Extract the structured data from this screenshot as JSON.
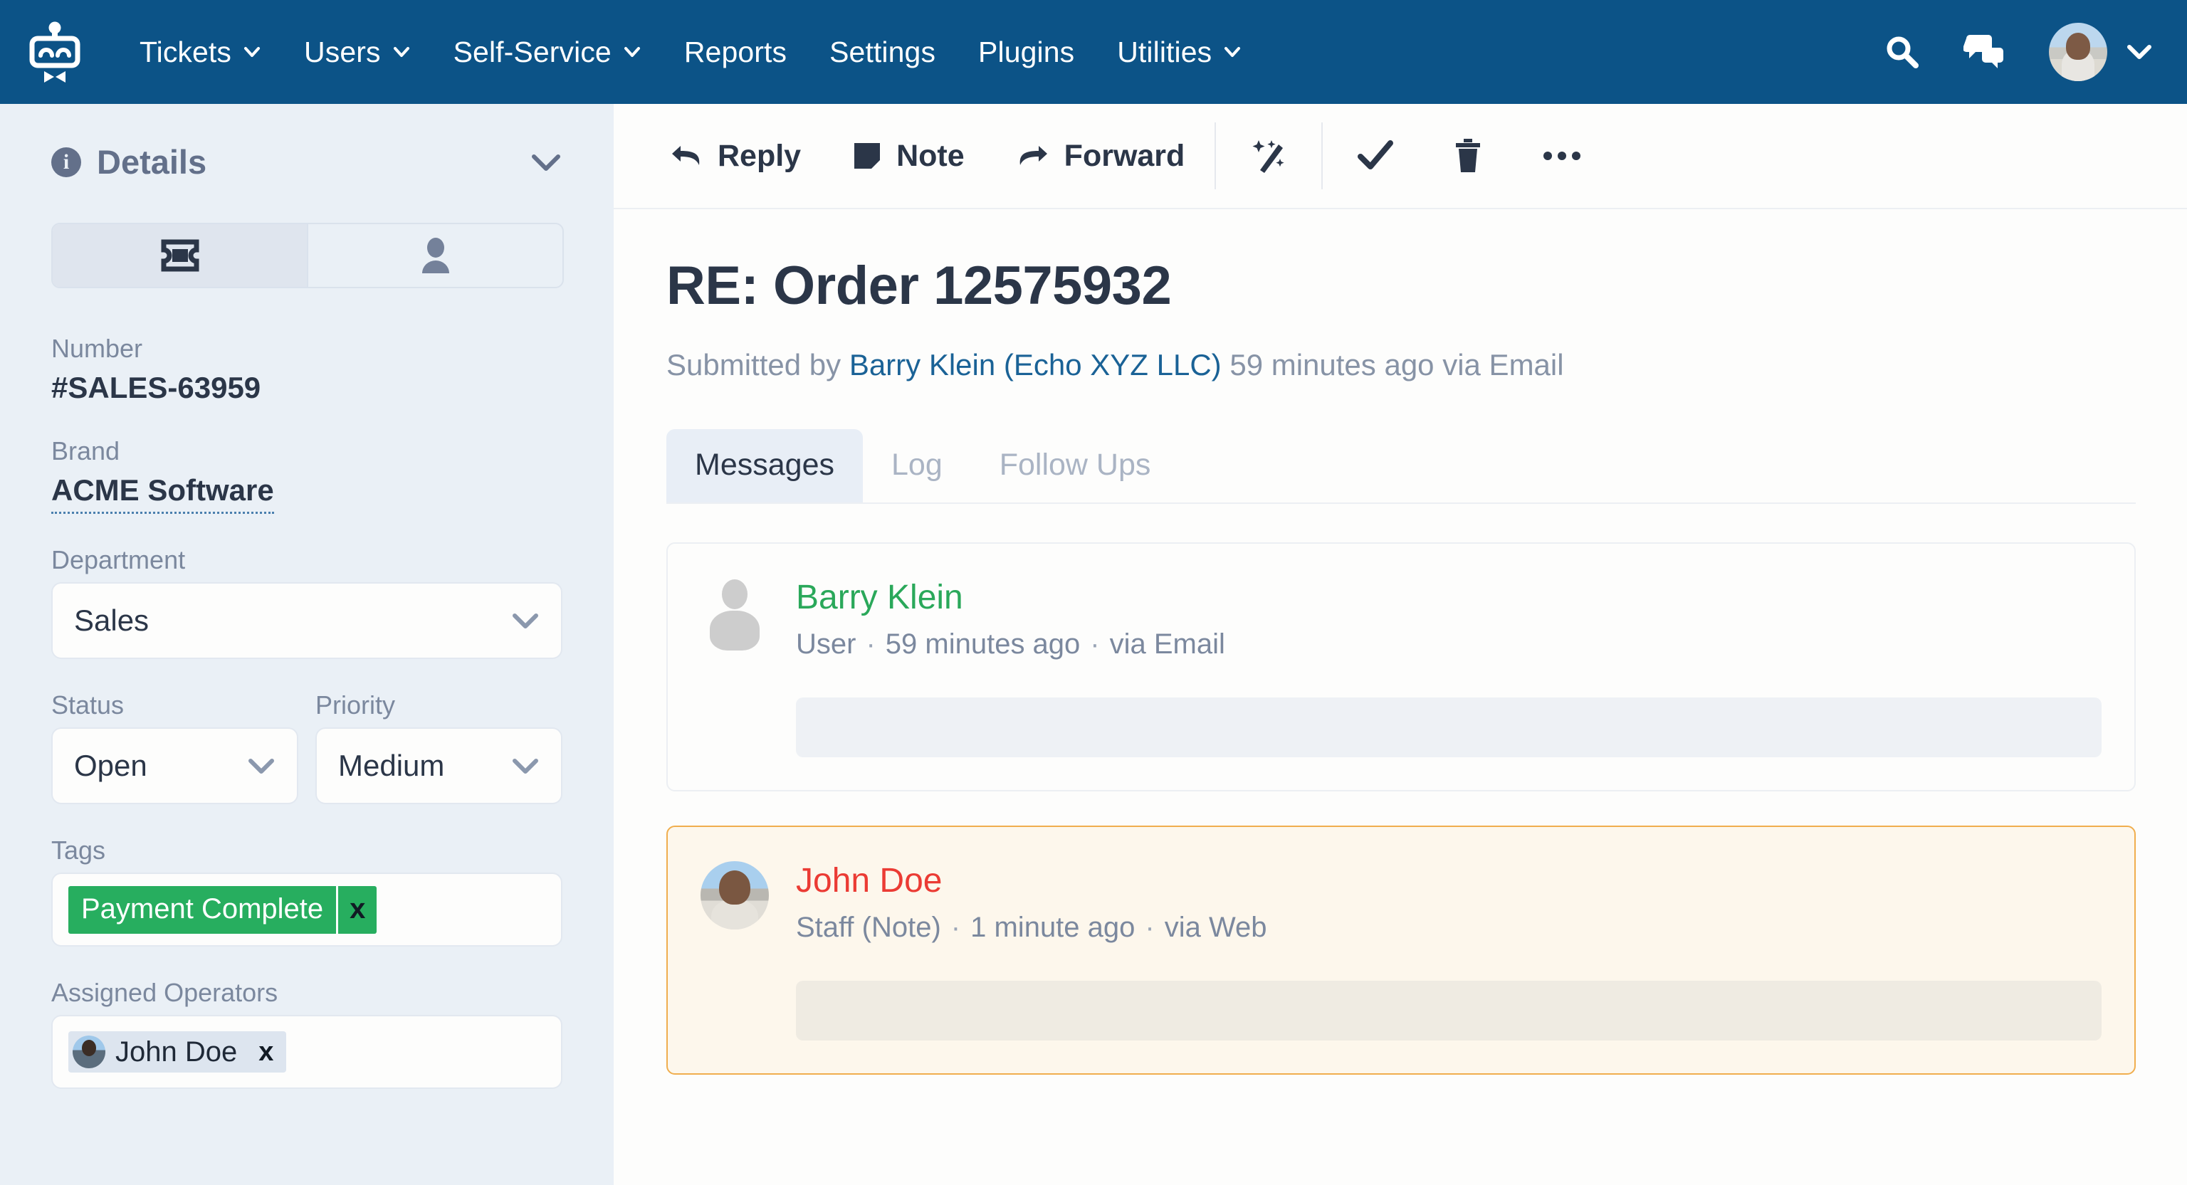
{
  "nav": {
    "logo_icon": "robot-logo-icon",
    "items": [
      {
        "label": "Tickets",
        "has_caret": true
      },
      {
        "label": "Users",
        "has_caret": true
      },
      {
        "label": "Self-Service",
        "has_caret": true
      },
      {
        "label": "Reports",
        "has_caret": false
      },
      {
        "label": "Settings",
        "has_caret": false
      },
      {
        "label": "Plugins",
        "has_caret": false
      },
      {
        "label": "Utilities",
        "has_caret": true
      }
    ],
    "search_icon": "search-icon",
    "chat_icon": "chat-bubbles-icon",
    "avatar_icon": "user-avatar",
    "account_caret_icon": "chevron-down-icon",
    "background_color": "#0c5387"
  },
  "sidebar": {
    "title": "Details",
    "info_icon": "info-circle-icon",
    "info_glyph": "i",
    "collapse_icon": "chevron-down-icon",
    "toggle": {
      "ticket_icon": "ticket-icon",
      "person_icon": "person-icon",
      "active": "ticket"
    },
    "fields": {
      "number_label": "Number",
      "number_value": "#SALES-63959",
      "brand_label": "Brand",
      "brand_value": "ACME Software",
      "department_label": "Department",
      "department_value": "Sales",
      "status_label": "Status",
      "status_value": "Open",
      "priority_label": "Priority",
      "priority_value": "Medium",
      "tags_label": "Tags",
      "tag_value": "Payment Complete",
      "tag_remove_glyph": "x",
      "tag_color": "#27ae5f",
      "operators_label": "Assigned Operators",
      "operator_name": "John Doe",
      "operator_remove_glyph": "x"
    },
    "select_caret_icon": "chevron-down-icon",
    "background_color": "#eaf0f6"
  },
  "toolbar": {
    "reply_label": "Reply",
    "reply_icon": "reply-arrow-icon",
    "note_label": "Note",
    "note_icon": "note-icon",
    "forward_label": "Forward",
    "forward_icon": "forward-arrow-icon",
    "magic_icon": "magic-wand-icon",
    "resolve_icon": "check-icon",
    "delete_icon": "trash-icon",
    "more_icon": "ellipsis-icon"
  },
  "ticket": {
    "title": "RE: Order 12575932",
    "submitted_prefix": "Submitted by ",
    "submitter_name": "Barry Klein",
    "submitter_org": "(Echo XYZ LLC)",
    "submitted_suffix": " 59 minutes ago via Email",
    "tabs": [
      {
        "label": "Messages",
        "active": true
      },
      {
        "label": "Log",
        "active": false
      },
      {
        "label": "Follow Ups",
        "active": false
      }
    ],
    "messages": [
      {
        "author": "Barry Klein",
        "author_color": "#2aa85a",
        "role": "User",
        "time": "59 minutes ago",
        "channel": "via Email",
        "separator": "·",
        "is_note": false,
        "avatar": "generic-person-avatar"
      },
      {
        "author": "John Doe",
        "author_color": "#eb3b34",
        "role": "Staff (Note)",
        "time": "1 minute ago",
        "channel": "via Web",
        "separator": "·",
        "is_note": true,
        "avatar": "john-doe-photo-avatar"
      }
    ]
  }
}
